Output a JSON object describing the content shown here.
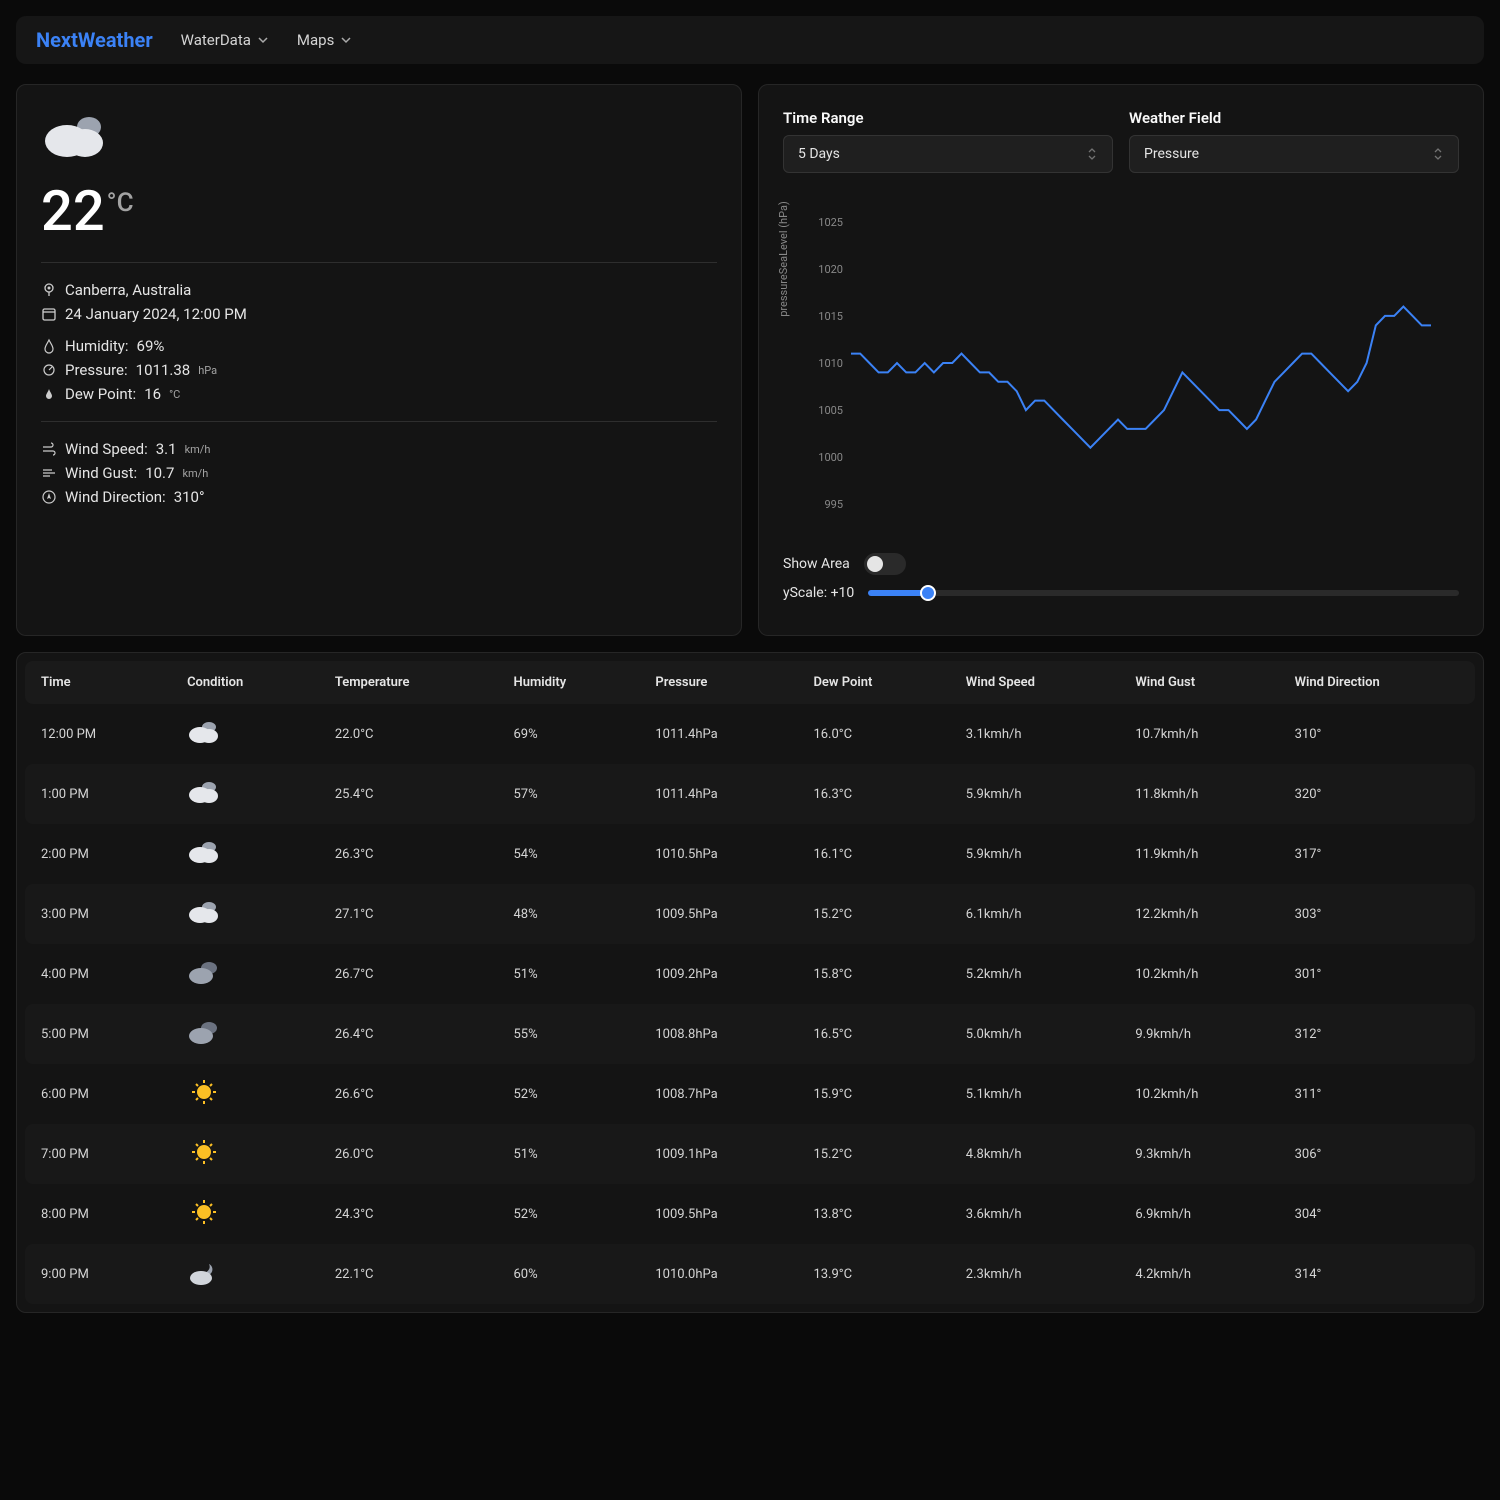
{
  "nav": {
    "brand": "NextWeather",
    "items": [
      "WaterData",
      "Maps"
    ]
  },
  "current": {
    "temp": "22",
    "temp_unit": "°C",
    "location": "Canberra, Australia",
    "datetime": "24 January 2024, 12:00 PM",
    "humidity_label": "Humidity:",
    "humidity_value": "69%",
    "pressure_label": "Pressure:",
    "pressure_value": "1011.38",
    "pressure_unit": "hPa",
    "dew_label": "Dew Point:",
    "dew_value": "16",
    "dew_unit": "°C",
    "windspeed_label": "Wind Speed:",
    "windspeed_value": "3.1",
    "windspeed_unit": "km/h",
    "windgust_label": "Wind Gust:",
    "windgust_value": "10.7",
    "windgust_unit": "km/h",
    "winddir_label": "Wind Direction:",
    "winddir_value": "310°"
  },
  "controls": {
    "timerange_label": "Time Range",
    "timerange_value": "5 Days",
    "field_label": "Weather Field",
    "field_value": "Pressure",
    "showarea_label": "Show Area",
    "yscale_label": "yScale: +10"
  },
  "chart_data": {
    "type": "line",
    "ylabel": "pressureSeaLevel (hPa)",
    "ylim": [
      993,
      1027
    ],
    "yticks": [
      995,
      1000,
      1005,
      1010,
      1015,
      1020,
      1025
    ],
    "values": [
      1011,
      1011,
      1010,
      1009,
      1009,
      1010,
      1009,
      1009,
      1010,
      1009,
      1010,
      1010,
      1011,
      1010,
      1009,
      1009,
      1008,
      1008,
      1007,
      1005,
      1006,
      1006,
      1005,
      1004,
      1003,
      1002,
      1001,
      1002,
      1003,
      1004,
      1003,
      1003,
      1003,
      1004,
      1005,
      1007,
      1009,
      1008,
      1007,
      1006,
      1005,
      1005,
      1004,
      1003,
      1004,
      1006,
      1008,
      1009,
      1010,
      1011,
      1011,
      1010,
      1009,
      1008,
      1007,
      1008,
      1010,
      1014,
      1015,
      1015,
      1016,
      1015,
      1014,
      1014
    ]
  },
  "table": {
    "headers": [
      "Time",
      "Condition",
      "Temperature",
      "Humidity",
      "Pressure",
      "Dew Point",
      "Wind Speed",
      "Wind Gust",
      "Wind Direction"
    ],
    "rows": [
      {
        "time": "12:00 PM",
        "cond": "cloudy",
        "temp": "22.0°C",
        "hum": "69%",
        "pres": "1011.4hPa",
        "dew": "16.0°C",
        "ws": "3.1kmh/h",
        "wg": "10.7kmh/h",
        "wd": "310°"
      },
      {
        "time": "1:00 PM",
        "cond": "cloudy",
        "temp": "25.4°C",
        "hum": "57%",
        "pres": "1011.4hPa",
        "dew": "16.3°C",
        "ws": "5.9kmh/h",
        "wg": "11.8kmh/h",
        "wd": "320°"
      },
      {
        "time": "2:00 PM",
        "cond": "cloudy",
        "temp": "26.3°C",
        "hum": "54%",
        "pres": "1010.5hPa",
        "dew": "16.1°C",
        "ws": "5.9kmh/h",
        "wg": "11.9kmh/h",
        "wd": "317°"
      },
      {
        "time": "3:00 PM",
        "cond": "cloudy",
        "temp": "27.1°C",
        "hum": "48%",
        "pres": "1009.5hPa",
        "dew": "15.2°C",
        "ws": "6.1kmh/h",
        "wg": "12.2kmh/h",
        "wd": "303°"
      },
      {
        "time": "4:00 PM",
        "cond": "cloudy-dark",
        "temp": "26.7°C",
        "hum": "51%",
        "pres": "1009.2hPa",
        "dew": "15.8°C",
        "ws": "5.2kmh/h",
        "wg": "10.2kmh/h",
        "wd": "301°"
      },
      {
        "time": "5:00 PM",
        "cond": "cloudy-dark",
        "temp": "26.4°C",
        "hum": "55%",
        "pres": "1008.8hPa",
        "dew": "16.5°C",
        "ws": "5.0kmh/h",
        "wg": "9.9kmh/h",
        "wd": "312°"
      },
      {
        "time": "6:00 PM",
        "cond": "sunny",
        "temp": "26.6°C",
        "hum": "52%",
        "pres": "1008.7hPa",
        "dew": "15.9°C",
        "ws": "5.1kmh/h",
        "wg": "10.2kmh/h",
        "wd": "311°"
      },
      {
        "time": "7:00 PM",
        "cond": "sunny",
        "temp": "26.0°C",
        "hum": "51%",
        "pres": "1009.1hPa",
        "dew": "15.2°C",
        "ws": "4.8kmh/h",
        "wg": "9.3kmh/h",
        "wd": "306°"
      },
      {
        "time": "8:00 PM",
        "cond": "sunny",
        "temp": "24.3°C",
        "hum": "52%",
        "pres": "1009.5hPa",
        "dew": "13.8°C",
        "ws": "3.6kmh/h",
        "wg": "6.9kmh/h",
        "wd": "304°"
      },
      {
        "time": "9:00 PM",
        "cond": "night-cloudy",
        "temp": "22.1°C",
        "hum": "60%",
        "pres": "1010.0hPa",
        "dew": "13.9°C",
        "ws": "2.3kmh/h",
        "wg": "4.2kmh/h",
        "wd": "314°"
      }
    ]
  }
}
